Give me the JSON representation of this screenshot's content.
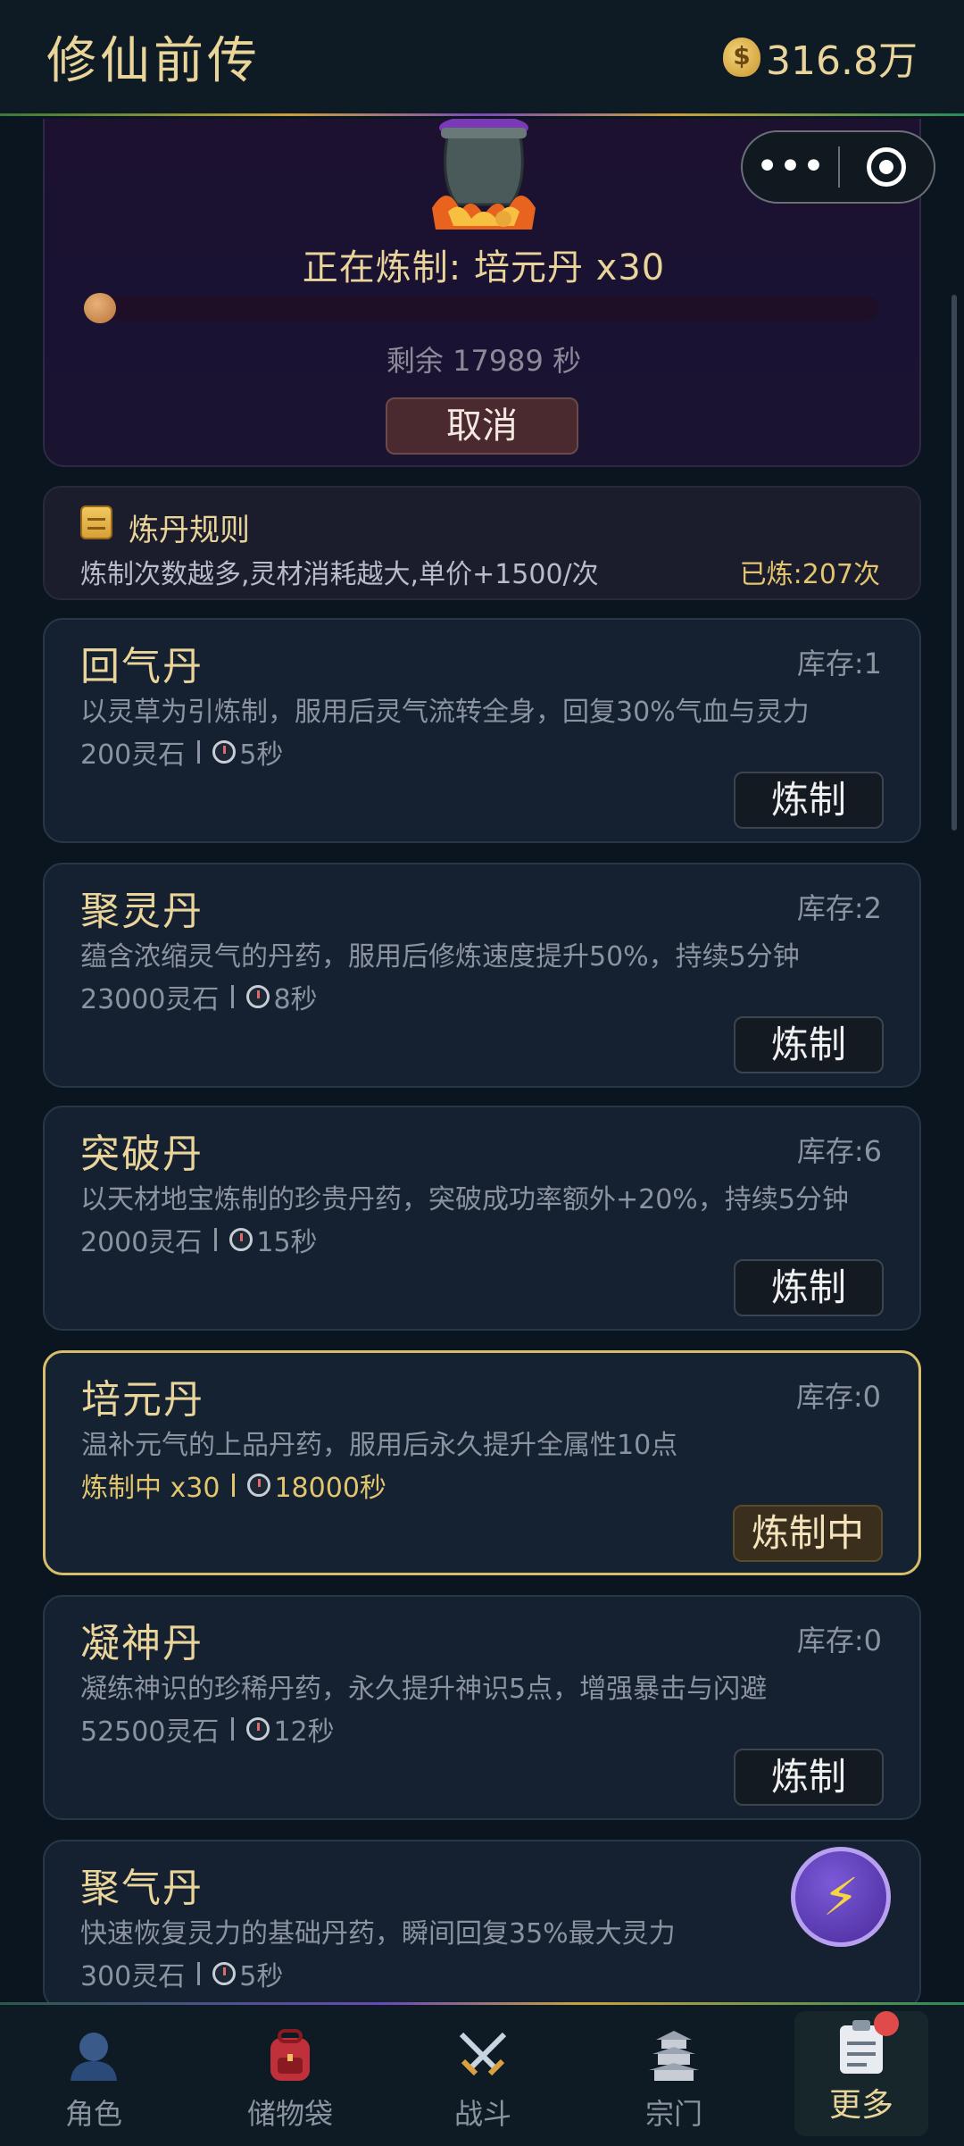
{
  "header": {
    "title": "修仙前传",
    "currency_icon": "money-bag-icon",
    "currency": "316.8万"
  },
  "miniprogram": {
    "more_icon": "more-dots-icon",
    "close_icon": "target-circle-icon"
  },
  "furnace": {
    "status": "正在炼制: 培元丹 x30",
    "progress_fraction": 0.01,
    "remaining": "剩余 17989 秒",
    "cancel_label": "取消"
  },
  "rules": {
    "icon": "scroll-icon",
    "title": "炼丹规则",
    "description": "炼制次数越多,灵材消耗越大,单价+1500/次",
    "crafted_count": "已炼:207次"
  },
  "pills": [
    {
      "name": "回气丹",
      "stock": "库存:1",
      "description": "以灵草为引炼制，服用后灵气流转全身，回复30%气血与灵力",
      "cost": "200灵石",
      "time": "5秒",
      "button": "炼制",
      "active": false
    },
    {
      "name": "聚灵丹",
      "stock": "库存:2",
      "description": "蕴含浓缩灵气的丹药，服用后修炼速度提升50%，持续5分钟",
      "cost": "23000灵石",
      "time": "8秒",
      "button": "炼制",
      "active": false
    },
    {
      "name": "突破丹",
      "stock": "库存:6",
      "description": "以天材地宝炼制的珍贵丹药，突破成功率额外+20%，持续5分钟",
      "cost": "2000灵石",
      "time": "15秒",
      "button": "炼制",
      "active": false
    },
    {
      "name": "培元丹",
      "stock": "库存:0",
      "description": "温补元气的上品丹药，服用后永久提升全属性10点",
      "cost": "炼制中 x30",
      "time": "18000秒",
      "button": "炼制中",
      "active": true
    },
    {
      "name": "凝神丹",
      "stock": "库存:0",
      "description": "凝练神识的珍稀丹药，永久提升神识5点，增强暴击与闪避",
      "cost": "52500灵石",
      "time": "12秒",
      "button": "炼制",
      "active": false
    },
    {
      "name": "聚气丹",
      "stock": "",
      "description": "快速恢复灵力的基础丹药，瞬间回复35%最大灵力",
      "cost": "300灵石",
      "time": "5秒",
      "button": "",
      "active": false
    }
  ],
  "float_button": {
    "icon": "lightning-icon",
    "glyph": "⚡"
  },
  "nav": [
    {
      "label": "角色",
      "icon": "character-icon"
    },
    {
      "label": "储物袋",
      "icon": "backpack-icon"
    },
    {
      "label": "战斗",
      "icon": "crossed-swords-icon"
    },
    {
      "label": "宗门",
      "icon": "pagoda-icon"
    },
    {
      "label": "更多",
      "icon": "clipboard-icon",
      "active": true
    }
  ]
}
